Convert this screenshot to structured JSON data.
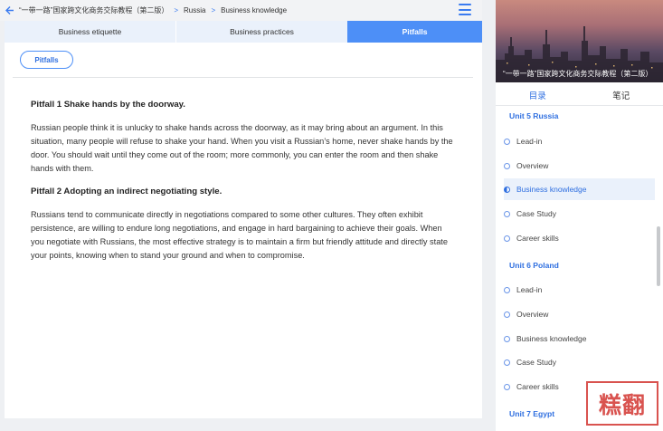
{
  "breadcrumb": {
    "book": "“一带一路”国家跨文化商务交际教程（第二版）",
    "unit": "Russia",
    "section": "Business knowledge"
  },
  "tabs": [
    {
      "label": "Business etiquette",
      "active": false
    },
    {
      "label": "Business practices",
      "active": false
    },
    {
      "label": "Pitfalls",
      "active": true
    }
  ],
  "content": {
    "pill_label": "Pitfalls",
    "pitfall1_title": "Pitfall 1 Shake hands by the doorway.",
    "pitfall1_body": "Russian people think it is unlucky to shake hands across the doorway, as it may bring about an argument. In this situation, many people will refuse to shake your hand. When you visit a Russian’s home, never shake hands by the door. You should wait until they come out of the room; more commonly, you can enter the room and then shake hands with them.",
    "pitfall2_title": "Pitfall 2 Adopting an indirect negotiating style.",
    "pitfall2_body": "Russians tend to communicate directly in negotiations compared to some other cultures. They often exhibit persistence, are willing to endure long negotiations, and engage in hard bargaining to achieve their goals. When you negotiate with Russians, the most effective strategy is to maintain a firm but friendly attitude and directly state your points, knowing when to stand your ground and when to compromise."
  },
  "sidebar": {
    "cover_title": "“一带一路”国家跨文化商务交际教程（第二版）",
    "tab_toc": "目录",
    "tab_notes": "笔记",
    "units": [
      {
        "title": "Unit 5 Russia",
        "items": [
          "Lead-in",
          "Overview",
          "Business knowledge",
          "Case Study",
          "Career skills"
        ]
      },
      {
        "title": "Unit 6 Poland",
        "items": [
          "Lead-in",
          "Overview",
          "Business knowledge",
          "Case Study",
          "Career skills"
        ]
      },
      {
        "title": "Unit 7 Egypt",
        "items": []
      }
    ],
    "active_item": "Business knowledge"
  },
  "watermark": "糕翻",
  "colors": {
    "accent": "#4d8ff7",
    "link": "#2f6fe0",
    "tab_bg": "#eaf1fb"
  }
}
